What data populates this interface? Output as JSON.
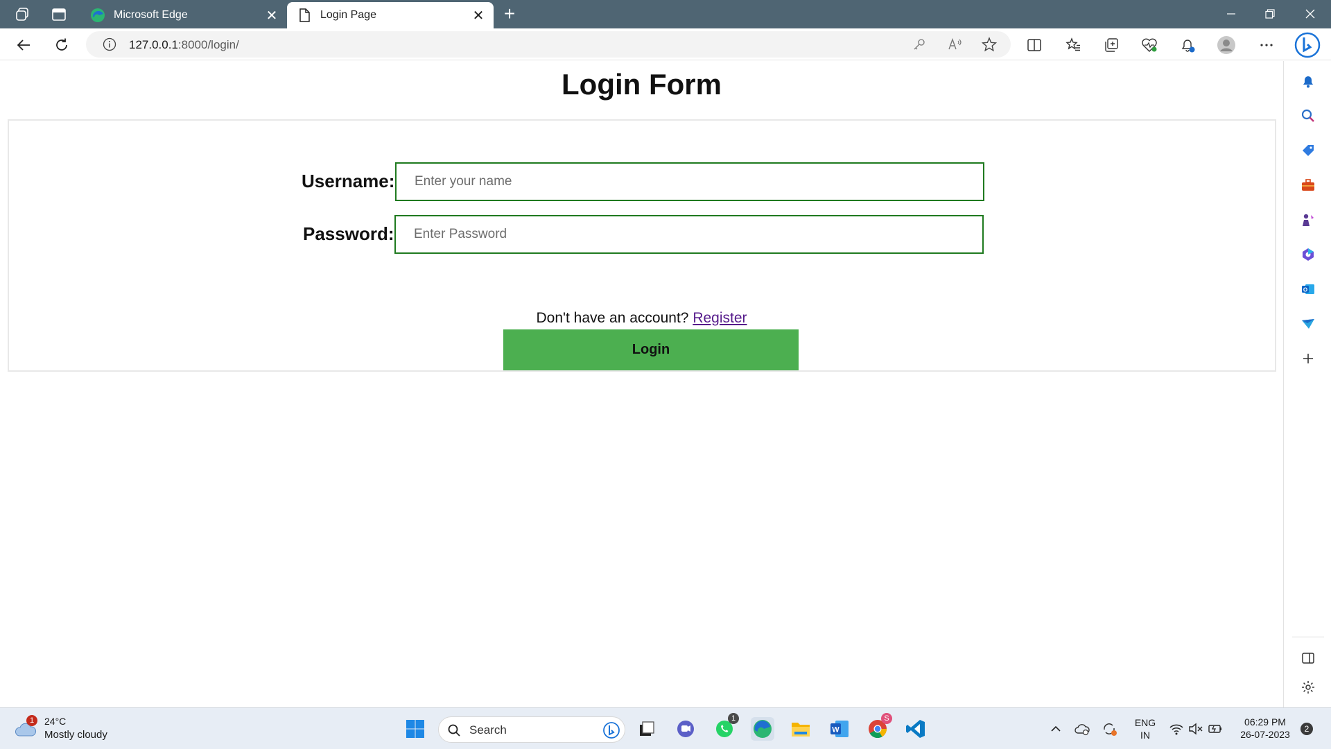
{
  "browser": {
    "tabs": [
      {
        "title": "Microsoft Edge",
        "icon": "edge-icon",
        "active": false
      },
      {
        "title": "Login Page",
        "icon": "page-icon",
        "active": true
      }
    ],
    "address": {
      "host": "127.0.0.1",
      "rest": ":8000/login/"
    }
  },
  "page": {
    "title": "Login Form",
    "username_label": "Username:",
    "username_placeholder": "Enter your name",
    "password_label": "Password:",
    "password_placeholder": "Enter Password",
    "login_button": "Login",
    "register_prompt": "Don't have an account?",
    "register_link": "Register",
    "colors": {
      "button": "#4caf50",
      "input_border": "#1f7a1f"
    }
  },
  "taskbar": {
    "weather_temp": "24°C",
    "weather_desc": "Mostly cloudy",
    "weather_badge": "1",
    "search_label": "Search",
    "whatsapp_badge": "1",
    "lang_line1": "ENG",
    "lang_line2": "IN",
    "time": "06:29 PM",
    "date": "26-07-2023",
    "notif_count": "2"
  }
}
